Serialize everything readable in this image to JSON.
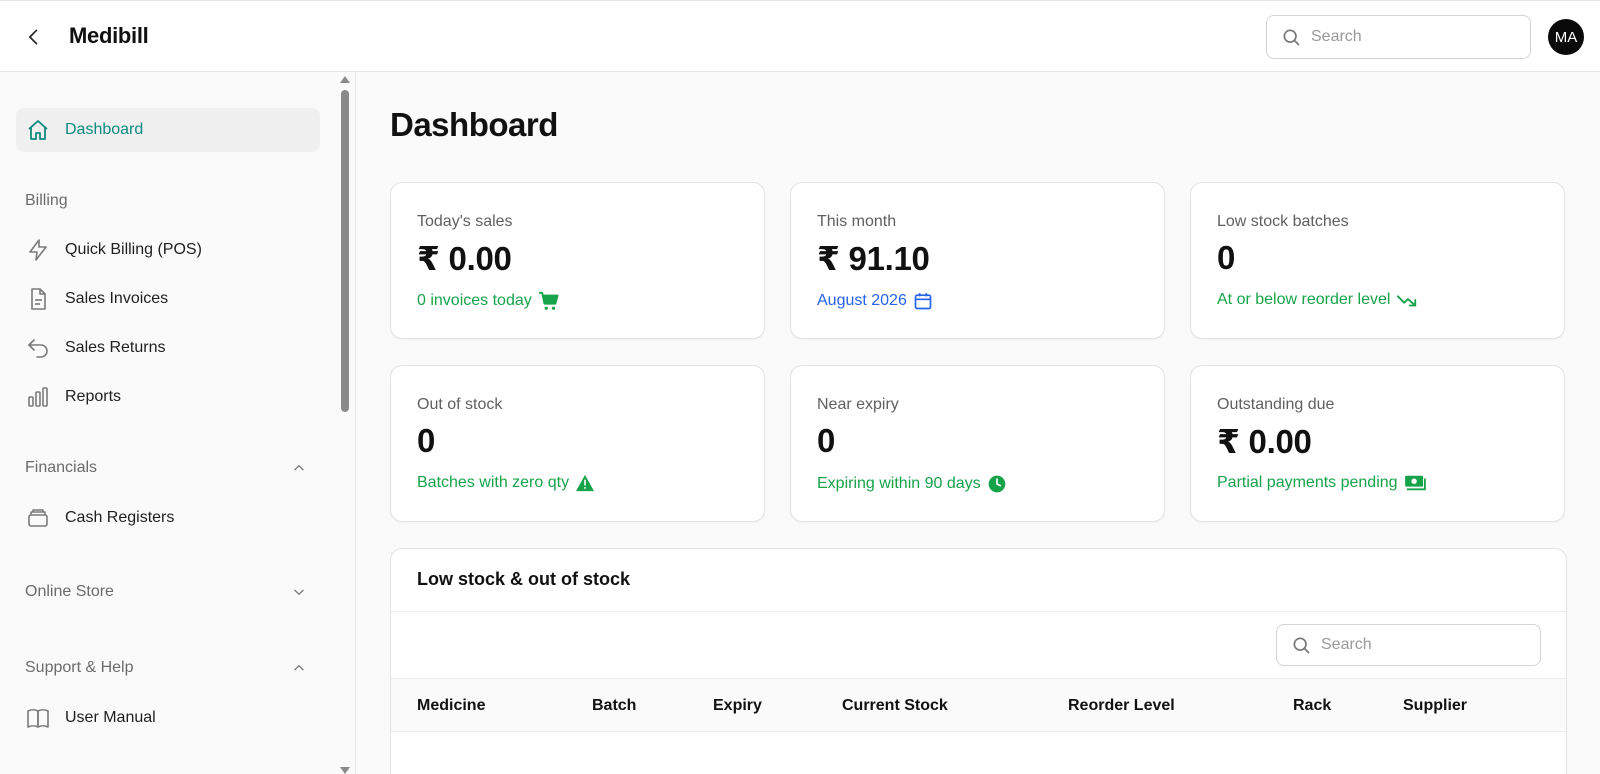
{
  "header": {
    "app_title": "Medibill",
    "search_placeholder": "Search",
    "avatar_initials": "MA"
  },
  "sidebar": {
    "dashboard": "Dashboard",
    "sections": {
      "billing": "Billing",
      "financials": "Financials",
      "online_store": "Online Store",
      "support": "Support & Help"
    },
    "billing_items": [
      "Quick Billing (POS)",
      "Sales Invoices",
      "Sales Returns",
      "Reports"
    ],
    "financials_items": [
      "Cash Registers"
    ],
    "support_items": [
      "User Manual"
    ]
  },
  "main": {
    "title": "Dashboard",
    "cards": [
      {
        "label": "Today's sales",
        "value": "₹ 0.00",
        "sub": "0 invoices today",
        "icon": "cart-icon",
        "tone": "green"
      },
      {
        "label": "This month",
        "value": "₹ 91.10",
        "sub": "August 2026",
        "icon": "calendar-icon",
        "tone": "blue"
      },
      {
        "label": "Low stock batches",
        "value": "0",
        "sub": "At or below reorder level",
        "icon": "trend-down-icon",
        "tone": "green"
      },
      {
        "label": "Out of stock",
        "value": "0",
        "sub": "Batches with zero qty",
        "icon": "warning-icon",
        "tone": "green"
      },
      {
        "label": "Near expiry",
        "value": "0",
        "sub": "Expiring within 90 days",
        "icon": "clock-icon",
        "tone": "green"
      },
      {
        "label": "Outstanding due",
        "value": "₹ 0.00",
        "sub": "Partial payments pending",
        "icon": "money-icon",
        "tone": "green"
      }
    ],
    "table": {
      "title": "Low stock & out of stock",
      "search_placeholder": "Search",
      "columns": [
        "Medicine",
        "Batch",
        "Expiry",
        "Current Stock",
        "Reorder Level",
        "Rack",
        "Supplier"
      ]
    }
  },
  "colors": {
    "accent_teal": "#0f8a7e",
    "green": "#16a34a",
    "blue": "#2563eb"
  }
}
